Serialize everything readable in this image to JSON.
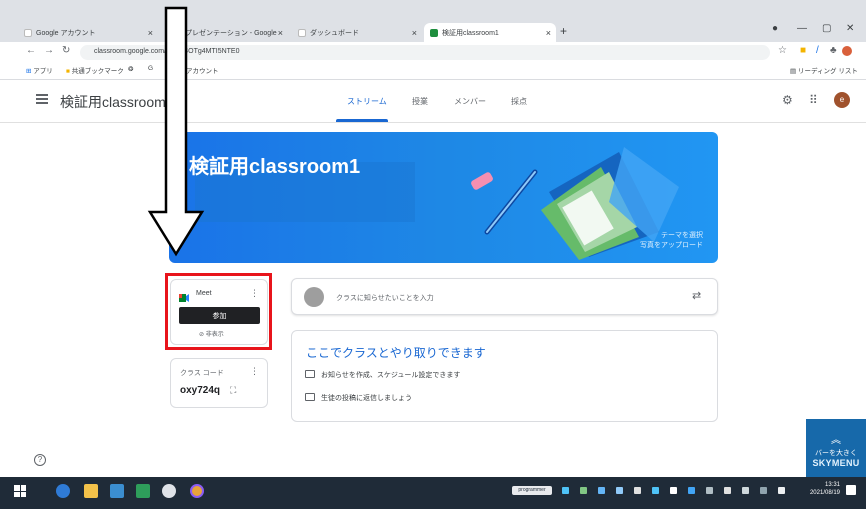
{
  "browser": {
    "tabs": [
      {
        "label": "Google アカウント"
      },
      {
        "label": "のプレゼンテーション - Google"
      },
      {
        "label": "ダッシュボード"
      },
      {
        "label": "検証用classroom1"
      }
    ],
    "url": "classroom.google.com/c/Mzc4OTg4MTI5NTE0",
    "bookmarks": [
      {
        "label": "アプリ"
      },
      {
        "label": "共通ブックマーク"
      },
      {
        "label": "G"
      },
      {
        "label": "アカウント"
      }
    ],
    "reading_list": "リーディング リスト"
  },
  "header": {
    "class_name": "検証用classroom1",
    "tabs": [
      {
        "label": "ストリーム"
      },
      {
        "label": "授業"
      },
      {
        "label": "メンバー"
      },
      {
        "label": "採点"
      }
    ],
    "avatar_letter": "e"
  },
  "banner": {
    "title": "検証用classroom1",
    "theme_link_1": "テーマを選択",
    "theme_link_2": "写真をアップロード"
  },
  "meet": {
    "label": "Meet",
    "join_button": "参加",
    "hide_label": "⊘ 非表示"
  },
  "class_code": {
    "label": "クラス コード",
    "value": "oxy724q"
  },
  "announce": {
    "placeholder": "クラスに知らせたいことを入力"
  },
  "info": {
    "title": "ここでクラスとやり取りできます",
    "row1": "お知らせを作成、スケジュール設定できます",
    "row2": "生徒の投稿に返信しましょう"
  },
  "skymenu": {
    "text": "バーを大きく",
    "logo": "SKYMENU"
  },
  "taskbar": {
    "badge": "programmer",
    "time": "13:31",
    "date": "2021/08/19"
  },
  "colors": {
    "accent": "#1967d2",
    "banner": "#1e88e5",
    "highlight": "#e8141b"
  }
}
